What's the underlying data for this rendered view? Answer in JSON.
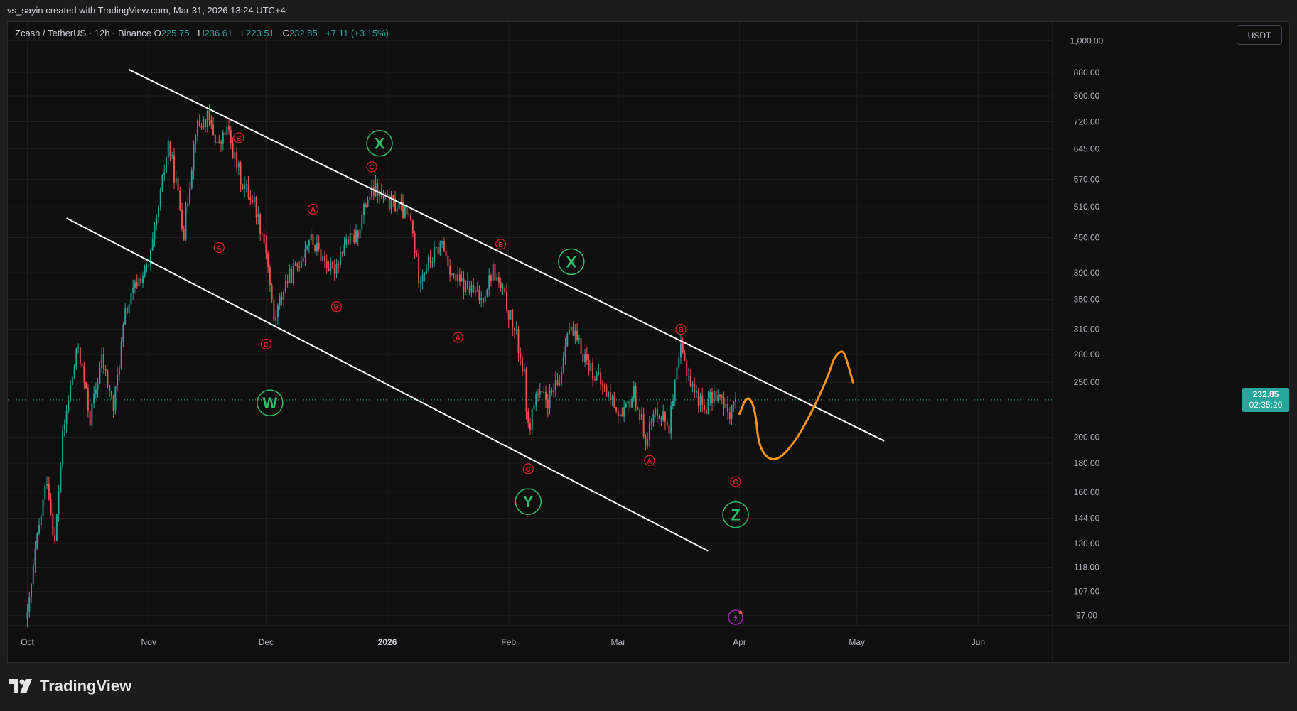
{
  "header": {
    "attribution": "vs_sayin created with TradingView.com, Mar 31, 2026 13:24 UTC+4"
  },
  "legend": {
    "symbol": "Zcash / TetherUS · 12h · Binance",
    "open_label": "O",
    "open": "225.75",
    "high_label": "H",
    "high": "236.61",
    "low_label": "L",
    "low": "223.51",
    "close_label": "C",
    "close": "232.85",
    "change": "+7.11 (+3.15%)"
  },
  "currency_button": "USDT",
  "last_price": {
    "price": "232.85",
    "countdown": "02:35:20"
  },
  "footer": {
    "brand": "TradingView"
  },
  "colors": {
    "up": "#26a69a",
    "down": "#ef5350",
    "wave_green": "#2ebd6b",
    "wave_red": "#e0212b",
    "trendline": "#ffffff",
    "projection": "#f7931a",
    "background": "#0f0f0f",
    "text": "#b2b5be"
  },
  "chart_data": {
    "type": "candlestick",
    "scale": "log",
    "ylim": [
      93,
      1080
    ],
    "xlim": [
      "2025-09-26",
      "2026-06-20"
    ],
    "x_ticks": [
      {
        "date": "2025-10-01",
        "label": "Oct"
      },
      {
        "date": "2025-11-01",
        "label": "Nov"
      },
      {
        "date": "2025-12-01",
        "label": "Dec"
      },
      {
        "date": "2026-01-01",
        "label": "2026",
        "bold": true
      },
      {
        "date": "2026-02-01",
        "label": "Feb"
      },
      {
        "date": "2026-03-01",
        "label": "Mar"
      },
      {
        "date": "2026-04-01",
        "label": "Apr"
      },
      {
        "date": "2026-05-01",
        "label": "May"
      },
      {
        "date": "2026-06-01",
        "label": "Jun"
      }
    ],
    "y_ticks": [
      {
        "value": 1000,
        "label": "1,000.00"
      },
      {
        "value": 880,
        "label": "880.00"
      },
      {
        "value": 800,
        "label": "800.00"
      },
      {
        "value": 720,
        "label": "720.00"
      },
      {
        "value": 645,
        "label": "645.00"
      },
      {
        "value": 570,
        "label": "570.00"
      },
      {
        "value": 510,
        "label": "510.00"
      },
      {
        "value": 450,
        "label": "450.00"
      },
      {
        "value": 390,
        "label": "390.00"
      },
      {
        "value": 350,
        "label": "350.00"
      },
      {
        "value": 310,
        "label": "310.00"
      },
      {
        "value": 280,
        "label": "280.00"
      },
      {
        "value": 250,
        "label": "250.00"
      },
      {
        "value": 200,
        "label": "200.00"
      },
      {
        "value": 180,
        "label": "180.00"
      },
      {
        "value": 160,
        "label": "160.00"
      },
      {
        "value": 144,
        "label": "144.00"
      },
      {
        "value": 130,
        "label": "130.00"
      },
      {
        "value": 118,
        "label": "118.00"
      },
      {
        "value": 107,
        "label": "107.00"
      },
      {
        "value": 97,
        "label": "97.00"
      }
    ],
    "last_price": 232.85,
    "price_path": [
      {
        "date": "2025-10-01",
        "price": 96
      },
      {
        "date": "2025-10-03",
        "price": 125
      },
      {
        "date": "2025-10-06",
        "price": 170
      },
      {
        "date": "2025-10-08",
        "price": 130
      },
      {
        "date": "2025-10-10",
        "price": 200
      },
      {
        "date": "2025-10-12",
        "price": 245
      },
      {
        "date": "2025-10-14",
        "price": 290
      },
      {
        "date": "2025-10-17",
        "price": 215
      },
      {
        "date": "2025-10-20",
        "price": 275
      },
      {
        "date": "2025-10-23",
        "price": 225
      },
      {
        "date": "2025-10-26",
        "price": 330
      },
      {
        "date": "2025-10-29",
        "price": 375
      },
      {
        "date": "2025-11-01",
        "price": 400
      },
      {
        "date": "2025-11-03",
        "price": 480
      },
      {
        "date": "2025-11-06",
        "price": 660
      },
      {
        "date": "2025-11-08",
        "price": 560
      },
      {
        "date": "2025-11-10",
        "price": 460
      },
      {
        "date": "2025-11-13",
        "price": 700
      },
      {
        "date": "2025-11-16",
        "price": 730
      },
      {
        "date": "2025-11-19",
        "price": 650
      },
      {
        "date": "2025-11-21",
        "price": 700
      },
      {
        "date": "2025-11-23",
        "price": 620
      },
      {
        "date": "2025-11-25",
        "price": 560
      },
      {
        "date": "2025-11-28",
        "price": 520
      },
      {
        "date": "2025-12-01",
        "price": 430
      },
      {
        "date": "2025-12-03",
        "price": 320
      },
      {
        "date": "2025-12-06",
        "price": 375
      },
      {
        "date": "2025-12-09",
        "price": 400
      },
      {
        "date": "2025-12-12",
        "price": 450
      },
      {
        "date": "2025-12-15",
        "price": 420
      },
      {
        "date": "2025-12-18",
        "price": 390
      },
      {
        "date": "2025-12-21",
        "price": 440
      },
      {
        "date": "2025-12-24",
        "price": 450
      },
      {
        "date": "2025-12-27",
        "price": 530
      },
      {
        "date": "2025-12-29",
        "price": 545
      },
      {
        "date": "2026-01-01",
        "price": 520
      },
      {
        "date": "2026-01-04",
        "price": 510
      },
      {
        "date": "2026-01-07",
        "price": 480
      },
      {
        "date": "2026-01-09",
        "price": 385
      },
      {
        "date": "2026-01-12",
        "price": 410
      },
      {
        "date": "2026-01-15",
        "price": 440
      },
      {
        "date": "2026-01-18",
        "price": 380
      },
      {
        "date": "2026-01-22",
        "price": 365
      },
      {
        "date": "2026-01-25",
        "price": 350
      },
      {
        "date": "2026-01-28",
        "price": 395
      },
      {
        "date": "2026-01-31",
        "price": 350
      },
      {
        "date": "2026-02-03",
        "price": 300
      },
      {
        "date": "2026-02-05",
        "price": 255
      },
      {
        "date": "2026-02-06",
        "price": 205
      },
      {
        "date": "2026-02-08",
        "price": 238
      },
      {
        "date": "2026-02-11",
        "price": 232
      },
      {
        "date": "2026-02-14",
        "price": 250
      },
      {
        "date": "2026-02-16",
        "price": 315
      },
      {
        "date": "2026-02-19",
        "price": 290
      },
      {
        "date": "2026-02-22",
        "price": 265
      },
      {
        "date": "2026-02-25",
        "price": 245
      },
      {
        "date": "2026-02-28",
        "price": 230
      },
      {
        "date": "2026-03-02",
        "price": 215
      },
      {
        "date": "2026-03-05",
        "price": 240
      },
      {
        "date": "2026-03-08",
        "price": 200
      },
      {
        "date": "2026-03-11",
        "price": 225
      },
      {
        "date": "2026-03-14",
        "price": 210
      },
      {
        "date": "2026-03-17",
        "price": 285
      },
      {
        "date": "2026-03-20",
        "price": 245
      },
      {
        "date": "2026-03-23",
        "price": 225
      },
      {
        "date": "2026-03-26",
        "price": 240
      },
      {
        "date": "2026-03-29",
        "price": 220
      },
      {
        "date": "2026-03-31",
        "price": 232.85
      }
    ],
    "channel_lines": [
      {
        "name": "upper",
        "from": {
          "date": "2025-10-27",
          "price": 890
        },
        "to": {
          "date": "2026-05-08",
          "price": 197
        }
      },
      {
        "name": "lower",
        "from": {
          "date": "2025-10-11",
          "price": 487
        },
        "to": {
          "date": "2026-03-24",
          "price": 126
        }
      }
    ],
    "projection_path": [
      {
        "date": "2026-04-01",
        "price": 220
      },
      {
        "date": "2026-04-03",
        "price": 238
      },
      {
        "date": "2026-04-05",
        "price": 225
      },
      {
        "date": "2026-04-06",
        "price": 190
      },
      {
        "date": "2026-04-10",
        "price": 180
      },
      {
        "date": "2026-04-15",
        "price": 195
      },
      {
        "date": "2026-04-20",
        "price": 225
      },
      {
        "date": "2026-04-24",
        "price": 260
      },
      {
        "date": "2026-04-25",
        "price": 275
      },
      {
        "date": "2026-04-27",
        "price": 285
      },
      {
        "date": "2026-04-28",
        "price": 280
      },
      {
        "date": "2026-04-30",
        "price": 250
      }
    ],
    "wave_labels_major": [
      {
        "label": "W",
        "date": "2025-12-02",
        "price": 230
      },
      {
        "label": "X",
        "date": "2025-12-30",
        "price": 660
      },
      {
        "label": "Y",
        "date": "2026-02-06",
        "price": 154
      },
      {
        "label": "X",
        "date": "2026-02-17",
        "price": 408
      },
      {
        "label": "Z",
        "date": "2026-03-31",
        "price": 146
      }
    ],
    "wave_labels_minor": [
      {
        "label": "A",
        "date": "2025-11-19",
        "price": 432
      },
      {
        "label": "B",
        "date": "2025-11-24",
        "price": 675
      },
      {
        "label": "C",
        "date": "2025-12-01",
        "price": 292
      },
      {
        "label": "A",
        "date": "2025-12-13",
        "price": 505
      },
      {
        "label": "B",
        "date": "2025-12-19",
        "price": 340
      },
      {
        "label": "C",
        "date": "2025-12-28",
        "price": 600
      },
      {
        "label": "A",
        "date": "2026-01-19",
        "price": 300
      },
      {
        "label": "B",
        "date": "2026-01-30",
        "price": 438
      },
      {
        "label": "C",
        "date": "2026-02-06",
        "price": 176
      },
      {
        "label": "A",
        "date": "2026-03-09",
        "price": 182
      },
      {
        "label": "B",
        "date": "2026-03-17",
        "price": 310
      },
      {
        "label": "C",
        "date": "2026-03-31",
        "price": 167
      }
    ]
  }
}
